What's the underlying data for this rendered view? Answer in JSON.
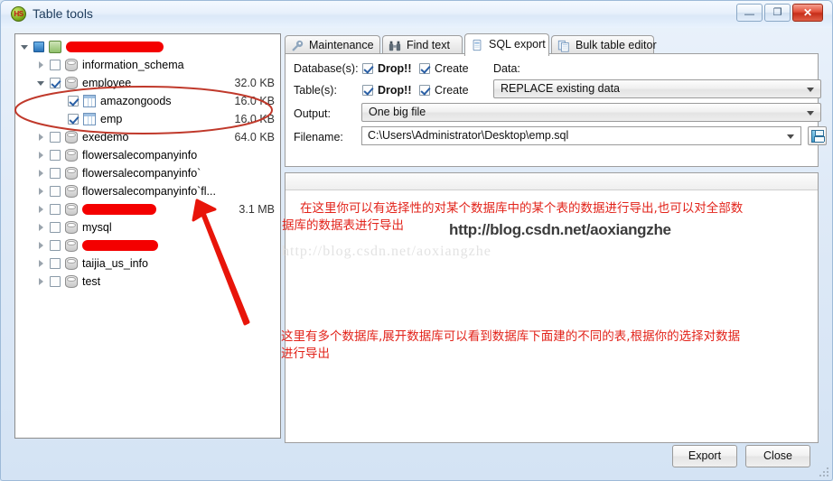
{
  "window": {
    "title": "Table tools",
    "icon": "HS",
    "controls": {
      "minimize": "—",
      "maximize": "❐",
      "close": "✕"
    }
  },
  "tree": {
    "items": [
      {
        "label": "",
        "redacted": true,
        "redact_width": 108,
        "size": "",
        "indent": 0,
        "twisty": "open",
        "checkbox": "filled",
        "icon": "server-icon"
      },
      {
        "label": "information_schema",
        "redacted": false,
        "size": "",
        "indent": 1,
        "twisty": "closed",
        "checkbox": "unchecked",
        "icon": "database-icon"
      },
      {
        "label": "employee",
        "redacted": false,
        "size": "32.0 KB",
        "indent": 1,
        "twisty": "open",
        "checkbox": "checked",
        "icon": "database-icon"
      },
      {
        "label": "amazongoods",
        "redacted": false,
        "size": "16.0 KB",
        "indent": 2,
        "twisty": "none",
        "checkbox": "checked",
        "icon": "table-icon"
      },
      {
        "label": "emp",
        "redacted": false,
        "size": "16.0 KB",
        "indent": 2,
        "twisty": "none",
        "checkbox": "checked",
        "icon": "table-icon"
      },
      {
        "label": "exedemo",
        "redacted": false,
        "size": "64.0 KB",
        "indent": 1,
        "twisty": "closed",
        "checkbox": "unchecked",
        "icon": "database-icon"
      },
      {
        "label": "flowersalecompanyinfo",
        "redacted": false,
        "size": "",
        "indent": 1,
        "twisty": "closed",
        "checkbox": "unchecked",
        "icon": "database-icon"
      },
      {
        "label": "flowersalecompanyinfo`",
        "redacted": false,
        "size": "",
        "indent": 1,
        "twisty": "closed",
        "checkbox": "unchecked",
        "icon": "database-icon"
      },
      {
        "label": "flowersalecompanyinfo`fl...",
        "redacted": false,
        "size": "",
        "indent": 1,
        "twisty": "closed",
        "checkbox": "unchecked",
        "icon": "database-icon"
      },
      {
        "label": "",
        "redacted": true,
        "redact_width": 82,
        "size": "3.1 MB",
        "indent": 1,
        "twisty": "closed",
        "checkbox": "unchecked",
        "icon": "database-icon"
      },
      {
        "label": "mysql",
        "redacted": false,
        "size": "",
        "indent": 1,
        "twisty": "closed",
        "checkbox": "unchecked",
        "icon": "database-icon"
      },
      {
        "label": "",
        "redacted": true,
        "redact_width": 84,
        "size": "",
        "indent": 1,
        "twisty": "closed",
        "checkbox": "unchecked",
        "icon": "database-icon"
      },
      {
        "label": "taijia_us_info",
        "redacted": false,
        "size": "",
        "indent": 1,
        "twisty": "closed",
        "checkbox": "unchecked",
        "icon": "database-icon"
      },
      {
        "label": "test",
        "redacted": false,
        "size": "",
        "indent": 1,
        "twisty": "closed",
        "checkbox": "unchecked",
        "icon": "database-icon"
      }
    ]
  },
  "tabs": [
    {
      "label": "Maintenance",
      "icon": "wrench-icon",
      "active": false
    },
    {
      "label": "Find text",
      "icon": "binoculars-icon",
      "active": false
    },
    {
      "label": "SQL export",
      "icon": "export-page-icon",
      "active": true
    },
    {
      "label": "Bulk table editor",
      "icon": "copy-pages-icon",
      "active": false
    }
  ],
  "form": {
    "databases_label": "Database(s):",
    "tables_label": "Table(s):",
    "output_label": "Output:",
    "filename_label": "Filename:",
    "data_label": "Data:",
    "db_drop": "Drop!!",
    "db_create": "Create",
    "tbl_drop": "Drop!!",
    "tbl_create": "Create",
    "data_value": "REPLACE existing data",
    "output_value": "One big file",
    "filename_value": "C:\\Users\\Administrator\\Desktop\\emp.sql"
  },
  "annotations": {
    "note_top_line1": "在这里你可以有选择性的对某个数据库中的某个表的数据进行导出,也可以对全部数",
    "note_top_line2": "据库的数据表进行导出",
    "note_bottom_line1": "这里有多个数据库,展开数据库可以看到数据库下面建的不同的表,根据你的选择对数据",
    "note_bottom_line2": "进行导出",
    "watermark_bold": "http://blog.csdn.net/aoxiangzhe",
    "watermark_faint": "http://blog.csdn.net/aoxiangzhe",
    "accent_color": "#e2231a"
  },
  "buttons": {
    "export": "Export",
    "close": "Close"
  }
}
